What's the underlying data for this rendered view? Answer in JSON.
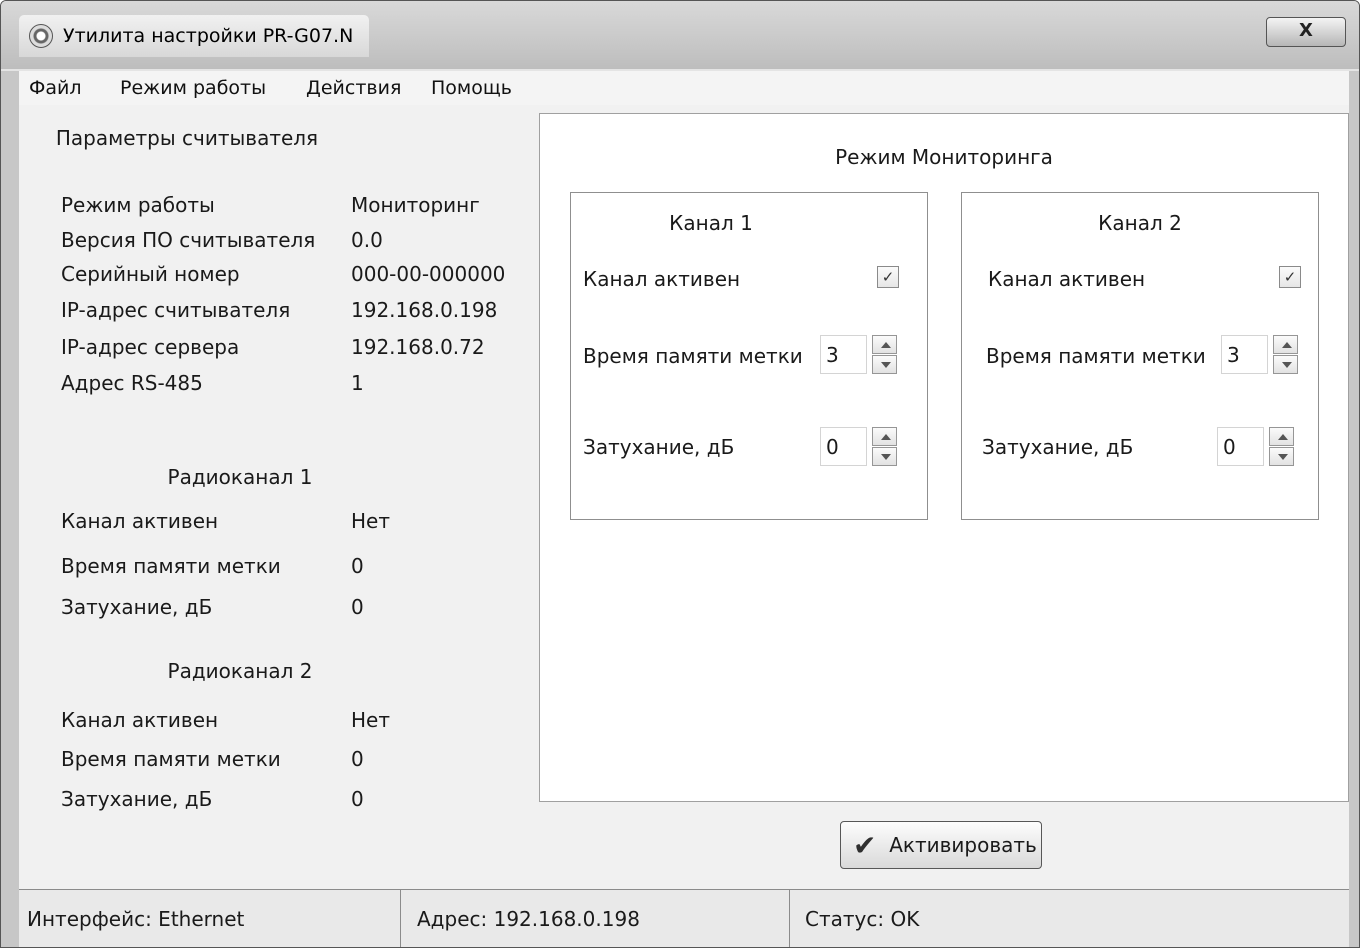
{
  "window": {
    "title": "Утилита настройки PR-G07.N",
    "close_glyph": "X"
  },
  "menu": [
    "Файл",
    "Режим работы",
    "Действия",
    "Помощь"
  ],
  "reader": {
    "title": "Параметры считывателя",
    "rows": [
      {
        "label": "Режим работы",
        "value": "Мониторинг"
      },
      {
        "label": "Версия ПО считывателя",
        "value": "0.0"
      },
      {
        "label": "Серийный номер",
        "value": "000-00-000000"
      },
      {
        "label": "IP-адрес считывателя",
        "value": "192.168.0.198"
      },
      {
        "label": "IP-адрес сервера",
        "value": "192.168.0.72"
      },
      {
        "label": "Адрес RS-485",
        "value": "1"
      }
    ]
  },
  "radio": [
    {
      "title": "Радиоканал 1",
      "rows": [
        {
          "label": "Канал активен",
          "value": "Нет"
        },
        {
          "label": "Время памяти метки",
          "value": "0"
        },
        {
          "label": "Затухание, дБ",
          "value": "0"
        }
      ]
    },
    {
      "title": "Радиоканал 2",
      "rows": [
        {
          "label": "Канал активен",
          "value": "Нет"
        },
        {
          "label": "Время памяти метки",
          "value": "0"
        },
        {
          "label": "Затухание, дБ",
          "value": "0"
        }
      ]
    }
  ],
  "monitoring": {
    "title": "Режим Мониторинга",
    "channels": [
      {
        "title": "Канал 1",
        "active_label": "Канал активен",
        "checked": true,
        "memory_label": "Время памяти метки",
        "memory_value": "3",
        "attenuation_label": "Затухание, дБ",
        "attenuation_value": "0"
      },
      {
        "title": "Канал 2",
        "active_label": "Канал активен",
        "checked": true,
        "memory_label": "Время памяти метки",
        "memory_value": "3",
        "attenuation_label": "Затухание, дБ",
        "attenuation_value": "0"
      }
    ],
    "activate_label": "Активировать"
  },
  "status": {
    "interface": "Интерфейс: Ethernet",
    "address": "Адрес: 192.168.0.198",
    "status": "Статус: OK"
  }
}
